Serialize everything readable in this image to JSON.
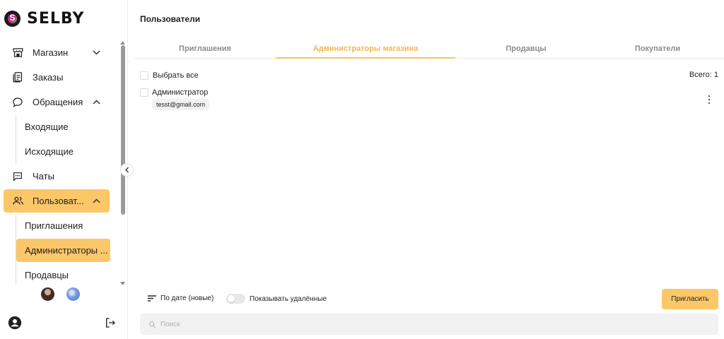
{
  "brand": {
    "name": "SELBY"
  },
  "sidebar": {
    "items": [
      {
        "label": "Магазин",
        "icon": "store-icon",
        "expand": "down"
      },
      {
        "label": "Заказы",
        "icon": "orders-icon"
      },
      {
        "label": "Обращения",
        "icon": "chat-bubble-icon",
        "expand": "up"
      },
      {
        "label": "Входящие"
      },
      {
        "label": "Исходящие"
      },
      {
        "label": "Чаты",
        "icon": "chats-icon"
      },
      {
        "label": "Пользоват...",
        "icon": "users-icon",
        "expand": "up"
      },
      {
        "label": "Приглашения"
      },
      {
        "label": "Администраторы ..."
      },
      {
        "label": "Продавцы"
      }
    ]
  },
  "header": {
    "title": "Пользователи"
  },
  "tabs": [
    {
      "label": "Приглашения"
    },
    {
      "label": "Администраторы магазина"
    },
    {
      "label": "Продавцы"
    },
    {
      "label": "Покупатели"
    }
  ],
  "list": {
    "select_all": "Выбрать все",
    "total": "Всего: 1",
    "rows": [
      {
        "role": "Администратор",
        "email": "tesst@gmail.com"
      }
    ]
  },
  "footer": {
    "sort_label": "По дате (новые)",
    "show_deleted_label": "Показывать удалённые",
    "invite_label": "Пригласить"
  },
  "search": {
    "placeholder": "Поиск"
  },
  "colors": {
    "accent": "#fcc769",
    "tab_active": "#f3b74f",
    "text": "#1f1f1f"
  }
}
